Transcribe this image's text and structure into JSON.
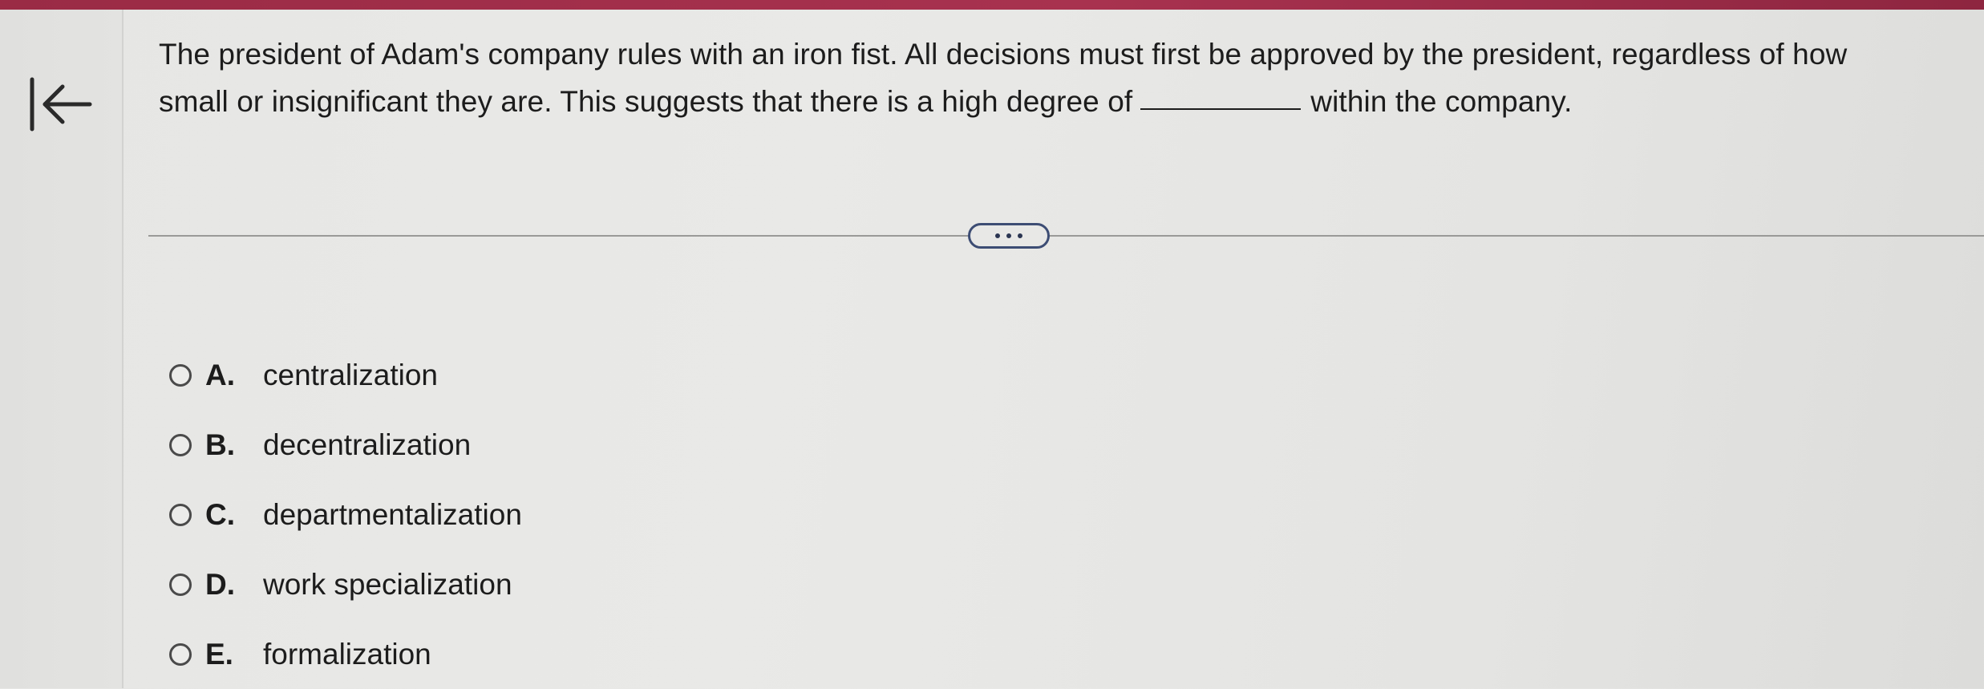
{
  "header": {
    "accent_color": "#a8324f"
  },
  "nav": {
    "back_icon": "arrow-left-to-bar-icon"
  },
  "question": {
    "text_before_blank": "The president of Adam's company rules with an iron fist. All decisions must first be approved by the president, regardless of how small or insignificant they are. This suggests that there is a high degree of",
    "text_after_blank": "within the company."
  },
  "more_button": {
    "icon": "ellipsis-icon",
    "border_color": "#3d4d74"
  },
  "options": [
    {
      "letter": "A.",
      "text": "centralization"
    },
    {
      "letter": "B.",
      "text": "decentralization"
    },
    {
      "letter": "C.",
      "text": "departmentalization"
    },
    {
      "letter": "D.",
      "text": "work specialization"
    },
    {
      "letter": "E.",
      "text": "formalization"
    }
  ]
}
